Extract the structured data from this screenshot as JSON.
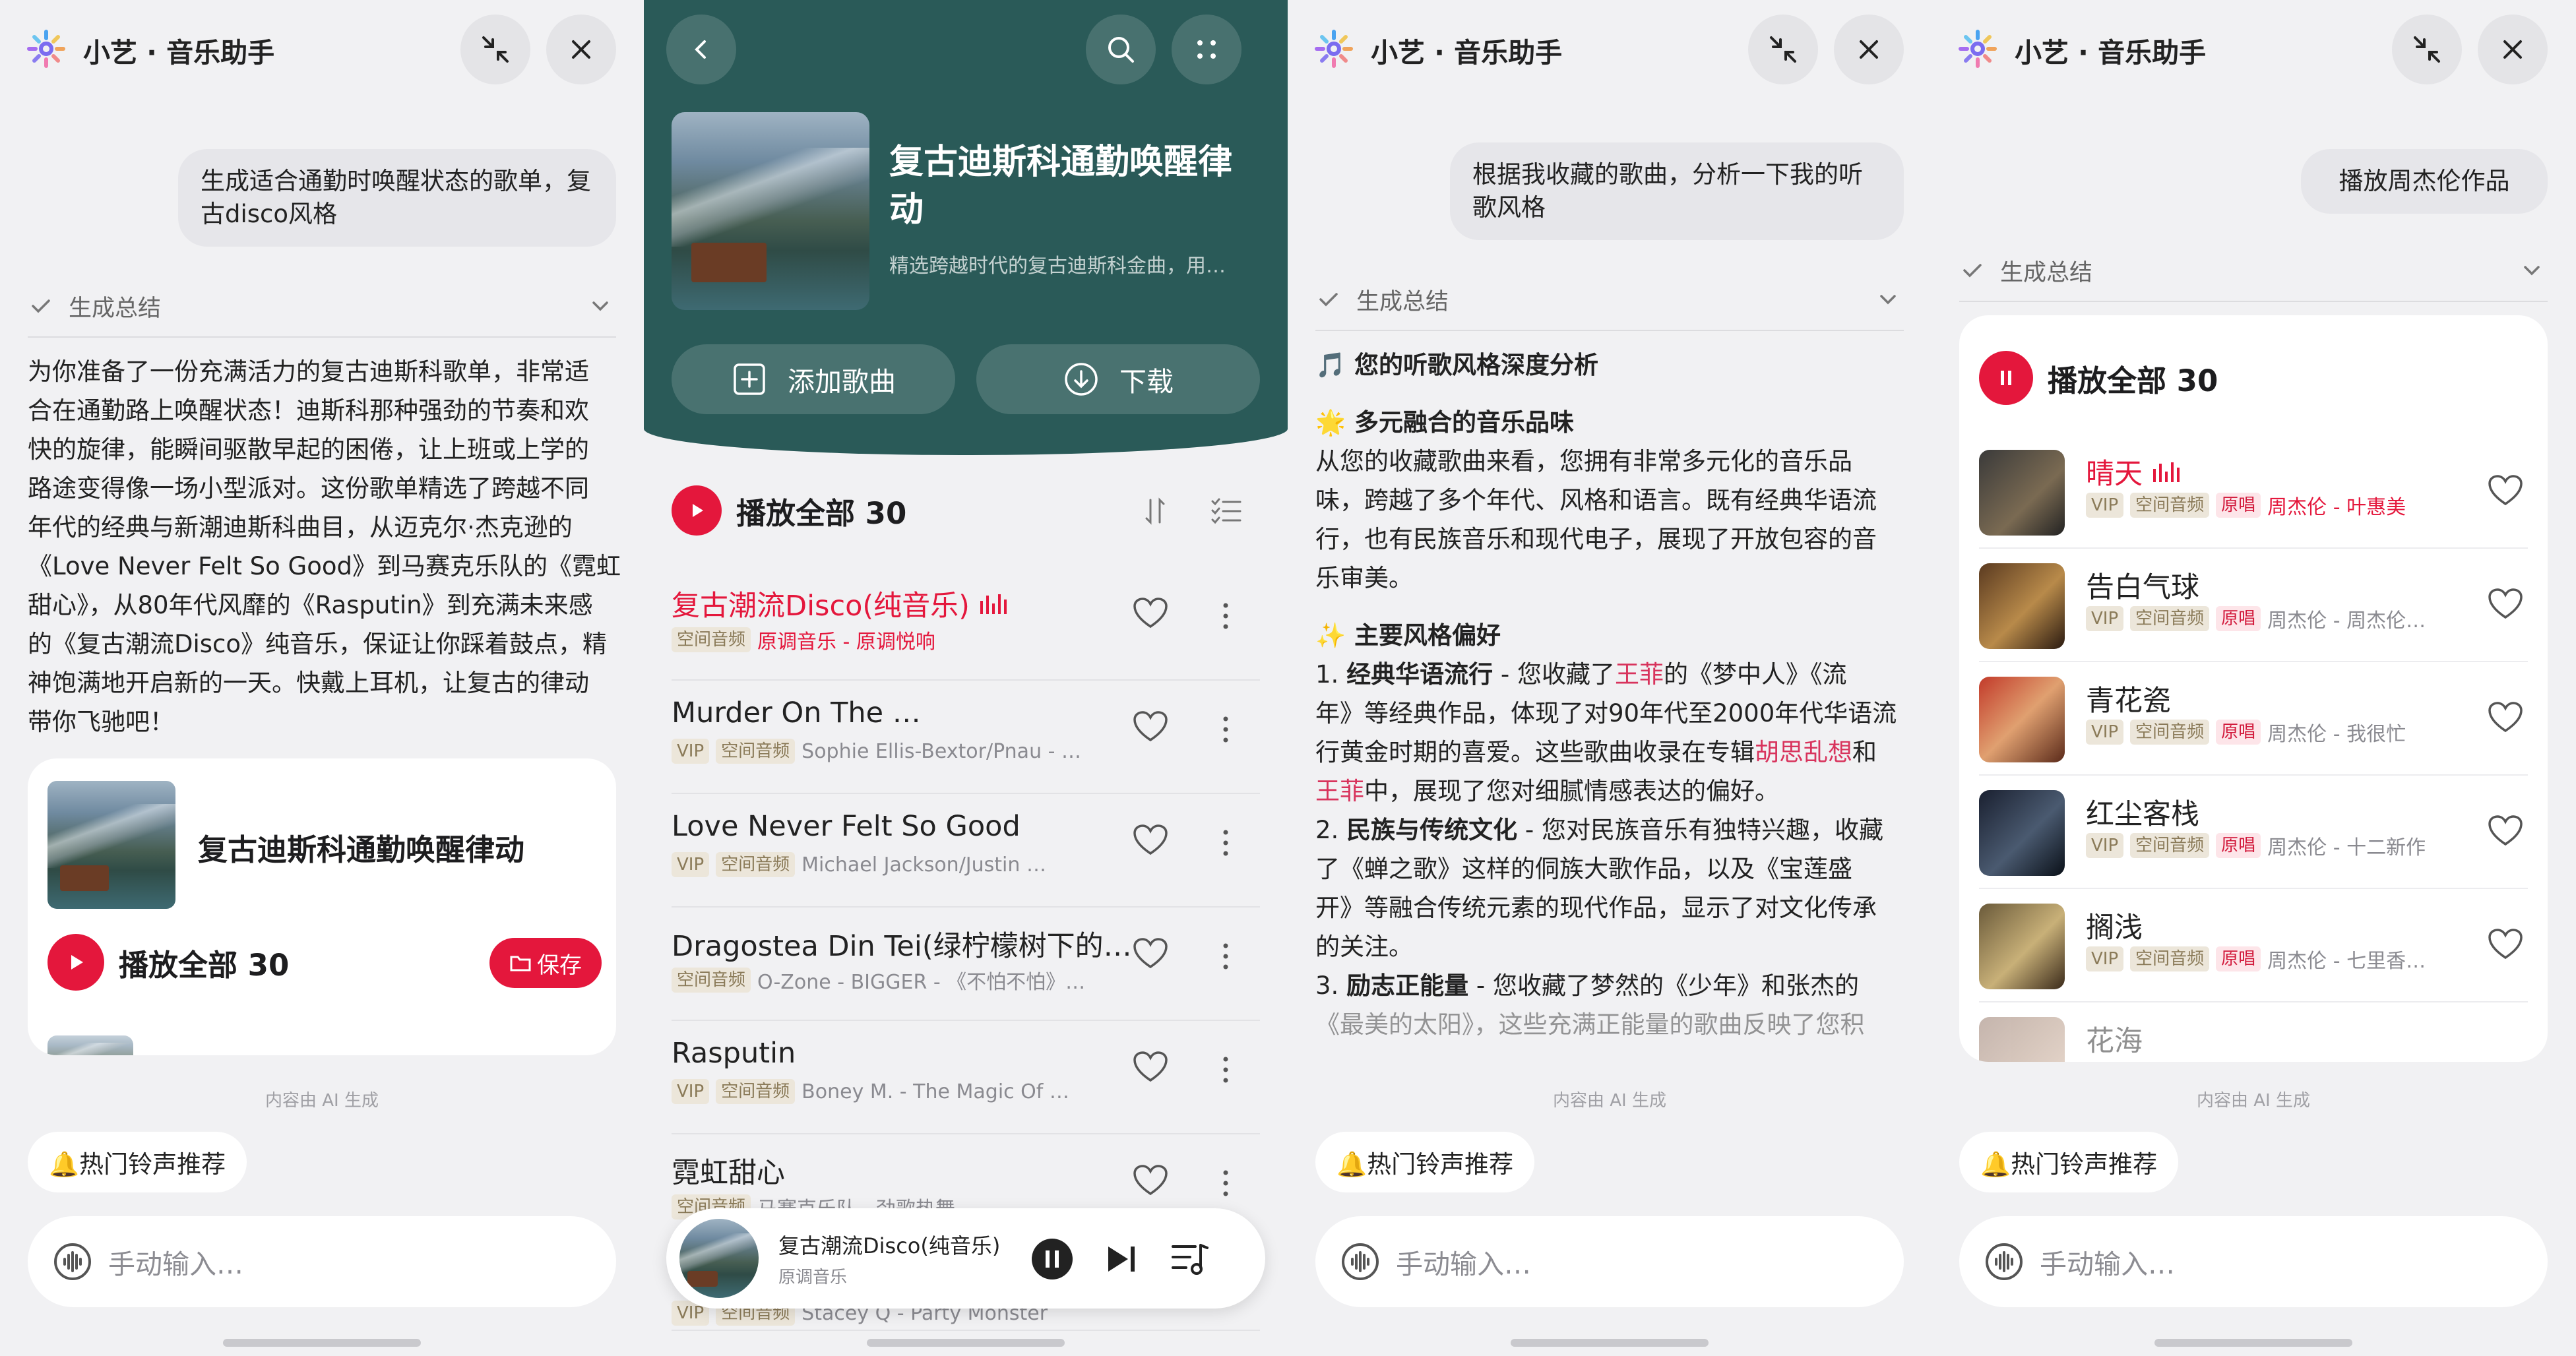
{
  "colors": {
    "accent": "#e4173c",
    "teal_header": "#2a5a58",
    "bg": "#f1f1f3"
  },
  "assistant": {
    "title": "小艺 · 音乐助手",
    "ai_note": "内容由 AI 生成",
    "ringtone_pill": "🔔热门铃声推荐",
    "input_placeholder": "手动输入…",
    "summary_label": "生成总结"
  },
  "pane1": {
    "user_message": [
      "生成适合通勤时唤醒状态的歌单，复",
      "古disco风格"
    ],
    "summary_lines": [
      "为你准备了一份充满活力的复古迪斯科歌单，非常适",
      "合在通勤路上唤醒状态！迪斯科那种强劲的节奏和欢",
      "快的旋律，能瞬间驱散早起的困倦，让上班或上学的",
      "路途变得像一场小型派对。这份歌单精选了跨越不同",
      "年代的经典与新潮迪斯科曲目，从迈克尔·杰克逊的",
      "《Love Never Felt So Good》到马赛克乐队的《霓虹",
      "甜心》，从80年代风靡的《Rasputin》到充满未来感",
      "的《复古潮流Disco》纯音乐，保证让你踩着鼓点，精",
      "神饱满地开启新的一天。快戴上耳机，让复古的律动",
      "带你飞驰吧！"
    ],
    "card_title": "复古迪斯科通勤唤醒律动",
    "play_all": "播放全部 30",
    "save": "保存"
  },
  "pane2": {
    "title_lines": [
      "复古迪斯科通勤唤醒律",
      "动"
    ],
    "desc": "精选跨越时代的复古迪斯科金曲，用…",
    "add_songs": "添加歌曲",
    "download": "下载",
    "play_all": "播放全部 30",
    "songs": [
      {
        "name": "复古潮流Disco(纯音乐)",
        "tags": [
          "空间音频"
        ],
        "artist": "原调音乐 - 原调悦响",
        "playing": true
      },
      {
        "name": "Murder On The …",
        "tags": [
          "VIP",
          "空间音频"
        ],
        "artist": "Sophie Ellis-Bextor/Pnau - …"
      },
      {
        "name": "Love Never Felt So Good",
        "tags": [
          "VIP",
          "空间音频"
        ],
        "artist": "Michael Jackson/Justin …"
      },
      {
        "name": "Dragostea Din Tei(绿柠檬树下的…",
        "tags": [
          "空间音频"
        ],
        "artist": "O-Zone - BIGGER - 《不怕不怕》…"
      },
      {
        "name": "Rasputin",
        "tags": [
          "VIP",
          "空间音频"
        ],
        "artist": "Boney M. - The Magic Of …"
      },
      {
        "name": "霓虹甜心",
        "tags": [
          "空间音频"
        ],
        "artist": "马赛克乐队 - 劲歌热舞"
      }
    ],
    "hidden_row": {
      "tags": [
        "VIP",
        "空间音频"
      ],
      "artist": "Stacey Q - Party Monster"
    },
    "mini_player": {
      "title": "复古潮流Disco(纯音乐)",
      "subtitle": "原调音乐"
    }
  },
  "pane3": {
    "user_message": [
      "根据我收藏的歌曲，分析一下我的听",
      "歌风格"
    ],
    "heading": "🎵 您的听歌风格深度分析",
    "section1_title": "🌟 多元融合的音乐品味",
    "section1_lines": [
      "从您的收藏歌曲来看，您拥有非常多元化的音乐品",
      "味，跨越了多个年代、风格和语言。既有经典华语流",
      "行，也有民族音乐和现代电子，展现了开放包容的音",
      "乐审美。"
    ],
    "section2_title": "✨ 主要风格偏好",
    "p1": [
      "1. ",
      "经典华语流行",
      " - 您收藏了",
      "王菲",
      "的《梦中人》《流"
    ],
    "p1b": "年》等经典作品，体现了对90年代至2000年代华语流",
    "p1c": [
      "行黄金时期的喜爱。这些歌曲收录在专辑",
      "胡思乱想",
      "和"
    ],
    "p1d": [
      "王菲",
      "中，展现了您对细腻情感表达的偏好。"
    ],
    "p2": [
      "2. ",
      "民族与传统文化",
      " - 您对民族音乐有独特兴趣，收藏"
    ],
    "p2b": "了《蝉之歌》这样的侗族大歌作品，以及《宝莲盛",
    "p2c": "开》等融合传统元素的现代作品，显示了对文化传承",
    "p2d": "的关注。",
    "p3": [
      "3. ",
      "励志正能量",
      " - 您收藏了梦然的《少年》和张杰的"
    ],
    "p3b": "《最美的太阳》，这些充满正能量的歌曲反映了您积"
  },
  "pane4": {
    "user_message": "播放周杰伦作品",
    "play_all": "播放全部 30",
    "songs": [
      {
        "name": "晴天",
        "artist": "周杰伦 - 叶惠美",
        "playing": true
      },
      {
        "name": "告白气球",
        "artist": "周杰伦 - 周杰伦…"
      },
      {
        "name": "青花瓷",
        "artist": "周杰伦 - 我很忙"
      },
      {
        "name": "红尘客栈",
        "artist": "周杰伦 - 十二新作"
      },
      {
        "name": "搁浅",
        "artist": "周杰伦 - 七里香…"
      },
      {
        "name": "花海",
        "artist": ""
      }
    ],
    "tags": [
      "VIP",
      "空间音频",
      "原唱"
    ]
  }
}
